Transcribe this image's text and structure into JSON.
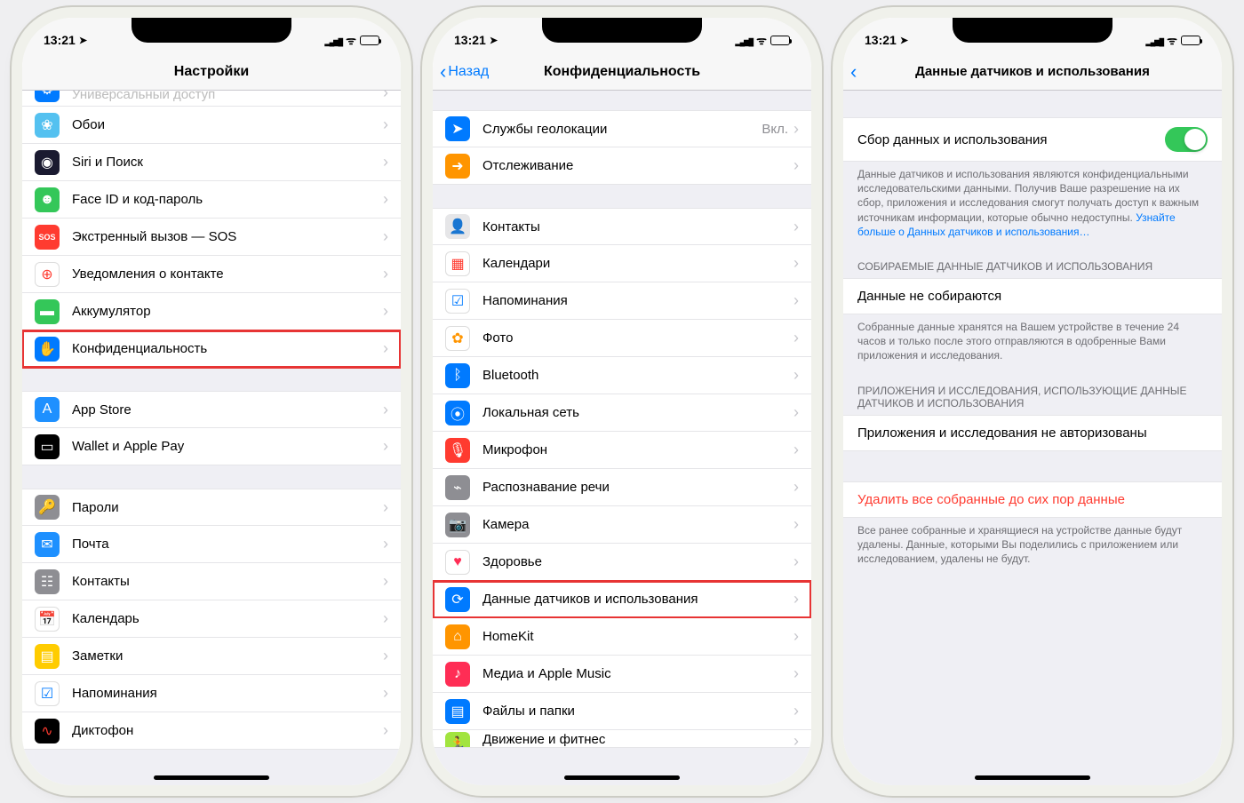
{
  "status": {
    "time": "13:21"
  },
  "p1": {
    "title": "Настройки",
    "rows_partial": {
      "label": "Универсальный доступ",
      "icon_bg": "#007aff",
      "glyph": "⚙︎"
    },
    "group1": [
      {
        "label": "Обои",
        "bg": "#54c1f0",
        "glyph": "❀"
      },
      {
        "label": "Siri и Поиск",
        "bg": "#1a1a30",
        "glyph": "◉"
      },
      {
        "label": "Face ID и код-пароль",
        "bg": "#34c759",
        "glyph": "☻"
      },
      {
        "label": "Экстренный вызов — SOS",
        "bg": "#ff3b30",
        "glyph": "SOS",
        "small": true
      },
      {
        "label": "Уведомления о контакте",
        "bg": "#fff",
        "glyph": "⊕",
        "fg": "#ff3b30",
        "border": true
      },
      {
        "label": "Аккумулятор",
        "bg": "#34c759",
        "glyph": "▬"
      },
      {
        "label": "Конфиденциальность",
        "bg": "#007aff",
        "glyph": "✋",
        "hl": true
      }
    ],
    "group2": [
      {
        "label": "App Store",
        "bg": "#1e90ff",
        "glyph": "A"
      },
      {
        "label": "Wallet и Apple Pay",
        "bg": "#000",
        "glyph": "▭"
      }
    ],
    "group3": [
      {
        "label": "Пароли",
        "bg": "#8e8e93",
        "glyph": "🔑"
      },
      {
        "label": "Почта",
        "bg": "#1e90ff",
        "glyph": "✉︎"
      },
      {
        "label": "Контакты",
        "bg": "#8e8e93",
        "glyph": "☷"
      },
      {
        "label": "Календарь",
        "bg": "#fff",
        "glyph": "📅",
        "fg": "#ff3b30",
        "border": true
      },
      {
        "label": "Заметки",
        "bg": "#ffcc00",
        "glyph": "▤"
      },
      {
        "label": "Напоминания",
        "bg": "#fff",
        "glyph": "☑︎",
        "fg": "#007aff",
        "border": true
      },
      {
        "label": "Диктофон",
        "bg": "#000",
        "glyph": "∿",
        "fg": "#ff3b30"
      }
    ]
  },
  "p2": {
    "back": "Назад",
    "title": "Конфиденциальность",
    "group1": [
      {
        "label": "Службы геолокации",
        "bg": "#007aff",
        "glyph": "➤",
        "detail": "Вкл."
      },
      {
        "label": "Отслеживание",
        "bg": "#ff9500",
        "glyph": "➜"
      }
    ],
    "group2": [
      {
        "label": "Контакты",
        "bg": "#e6e6e8",
        "glyph": "👤",
        "fg": "#8e8e93"
      },
      {
        "label": "Календари",
        "bg": "#fff",
        "glyph": "▦",
        "fg": "#ff3b30",
        "border": true
      },
      {
        "label": "Напоминания",
        "bg": "#fff",
        "glyph": "☑︎",
        "fg": "#007aff",
        "border": true
      },
      {
        "label": "Фото",
        "bg": "#fff",
        "glyph": "✿",
        "fg": "#ff9500",
        "border": true
      },
      {
        "label": "Bluetooth",
        "bg": "#007aff",
        "glyph": "ᛒ"
      },
      {
        "label": "Локальная сеть",
        "bg": "#007aff",
        "glyph": "⦿"
      },
      {
        "label": "Микрофон",
        "bg": "#ff3b30",
        "glyph": "🎙"
      },
      {
        "label": "Распознавание речи",
        "bg": "#8e8e93",
        "glyph": "⌁"
      },
      {
        "label": "Камера",
        "bg": "#8e8e93",
        "glyph": "📷"
      },
      {
        "label": "Здоровье",
        "bg": "#fff",
        "glyph": "♥︎",
        "fg": "#ff2d55",
        "border": true
      },
      {
        "label": "Данные датчиков и использования",
        "bg": "#007aff",
        "glyph": "⟳",
        "hl": true
      },
      {
        "label": "HomeKit",
        "bg": "#ff9500",
        "glyph": "⌂"
      },
      {
        "label": "Медиа и Apple Music",
        "bg": "#ff2d55",
        "glyph": "♪"
      },
      {
        "label": "Файлы и папки",
        "bg": "#007aff",
        "glyph": "▤"
      },
      {
        "label": "Движение и фитнес",
        "bg": "#a2e43f",
        "glyph": "🏃",
        "partial": true
      }
    ]
  },
  "p3": {
    "title": "Данные датчиков и использования",
    "toggle_label": "Сбор данных и использования",
    "note1": "Данные датчиков и использования являются конфиденциальными исследовательскими данными. Получив Ваше разрешение на их сбор, приложения и исследования смогут получать доступ к важным источникам информации, которые обычно недоступны.",
    "link1": "Узнайте больше о Данных датчиков и использования…",
    "header1": "СОБИРАЕМЫЕ ДАННЫЕ ДАТЧИКОВ И ИСПОЛЬЗОВАНИЯ",
    "cell1": "Данные не собираются",
    "note2": "Собранные данные хранятся на Вашем устройстве в течение 24 часов и только после этого отправляются в одобренные Вами приложения и исследования.",
    "header2": "ПРИЛОЖЕНИЯ И ИССЛЕДОВАНИЯ, ИСПОЛЬЗУЮЩИЕ ДАННЫЕ ДАТЧИКОВ И ИСПОЛЬЗОВАНИЯ",
    "cell2": "Приложения и исследования не авторизованы",
    "cell3": "Удалить все собранные до сих пор данные",
    "note3": "Все ранее собранные и хранящиеся на устройстве данные будут удалены. Данные, которыми Вы поделились с приложением или исследованием, удалены не будут."
  }
}
